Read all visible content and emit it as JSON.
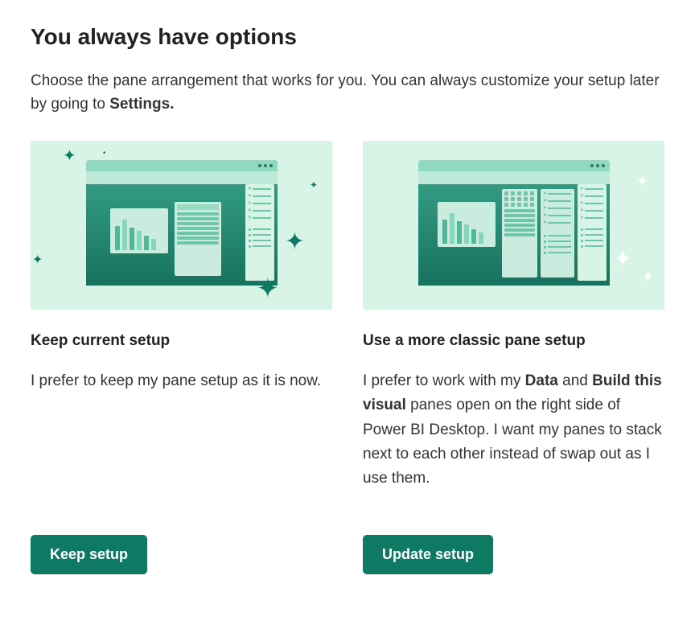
{
  "title": "You always have options",
  "subtitle_prefix": "Choose the pane arrangement that works for you. You can always customize your setup later by going to ",
  "subtitle_bold": "Settings.",
  "options": {
    "current": {
      "title": "Keep current setup",
      "desc": "I prefer to keep my pane setup as it is now.",
      "button": "Keep setup"
    },
    "classic": {
      "title": "Use a more classic pane setup",
      "desc_prefix": "I prefer to work with my ",
      "desc_bold1": "Data",
      "desc_mid1": " and ",
      "desc_bold2": "Build this visual",
      "desc_suffix": " panes open on the right side of Power BI Desktop. I want my panes to stack next to each other instead of swap out as I use them.",
      "button": "Update setup"
    }
  }
}
